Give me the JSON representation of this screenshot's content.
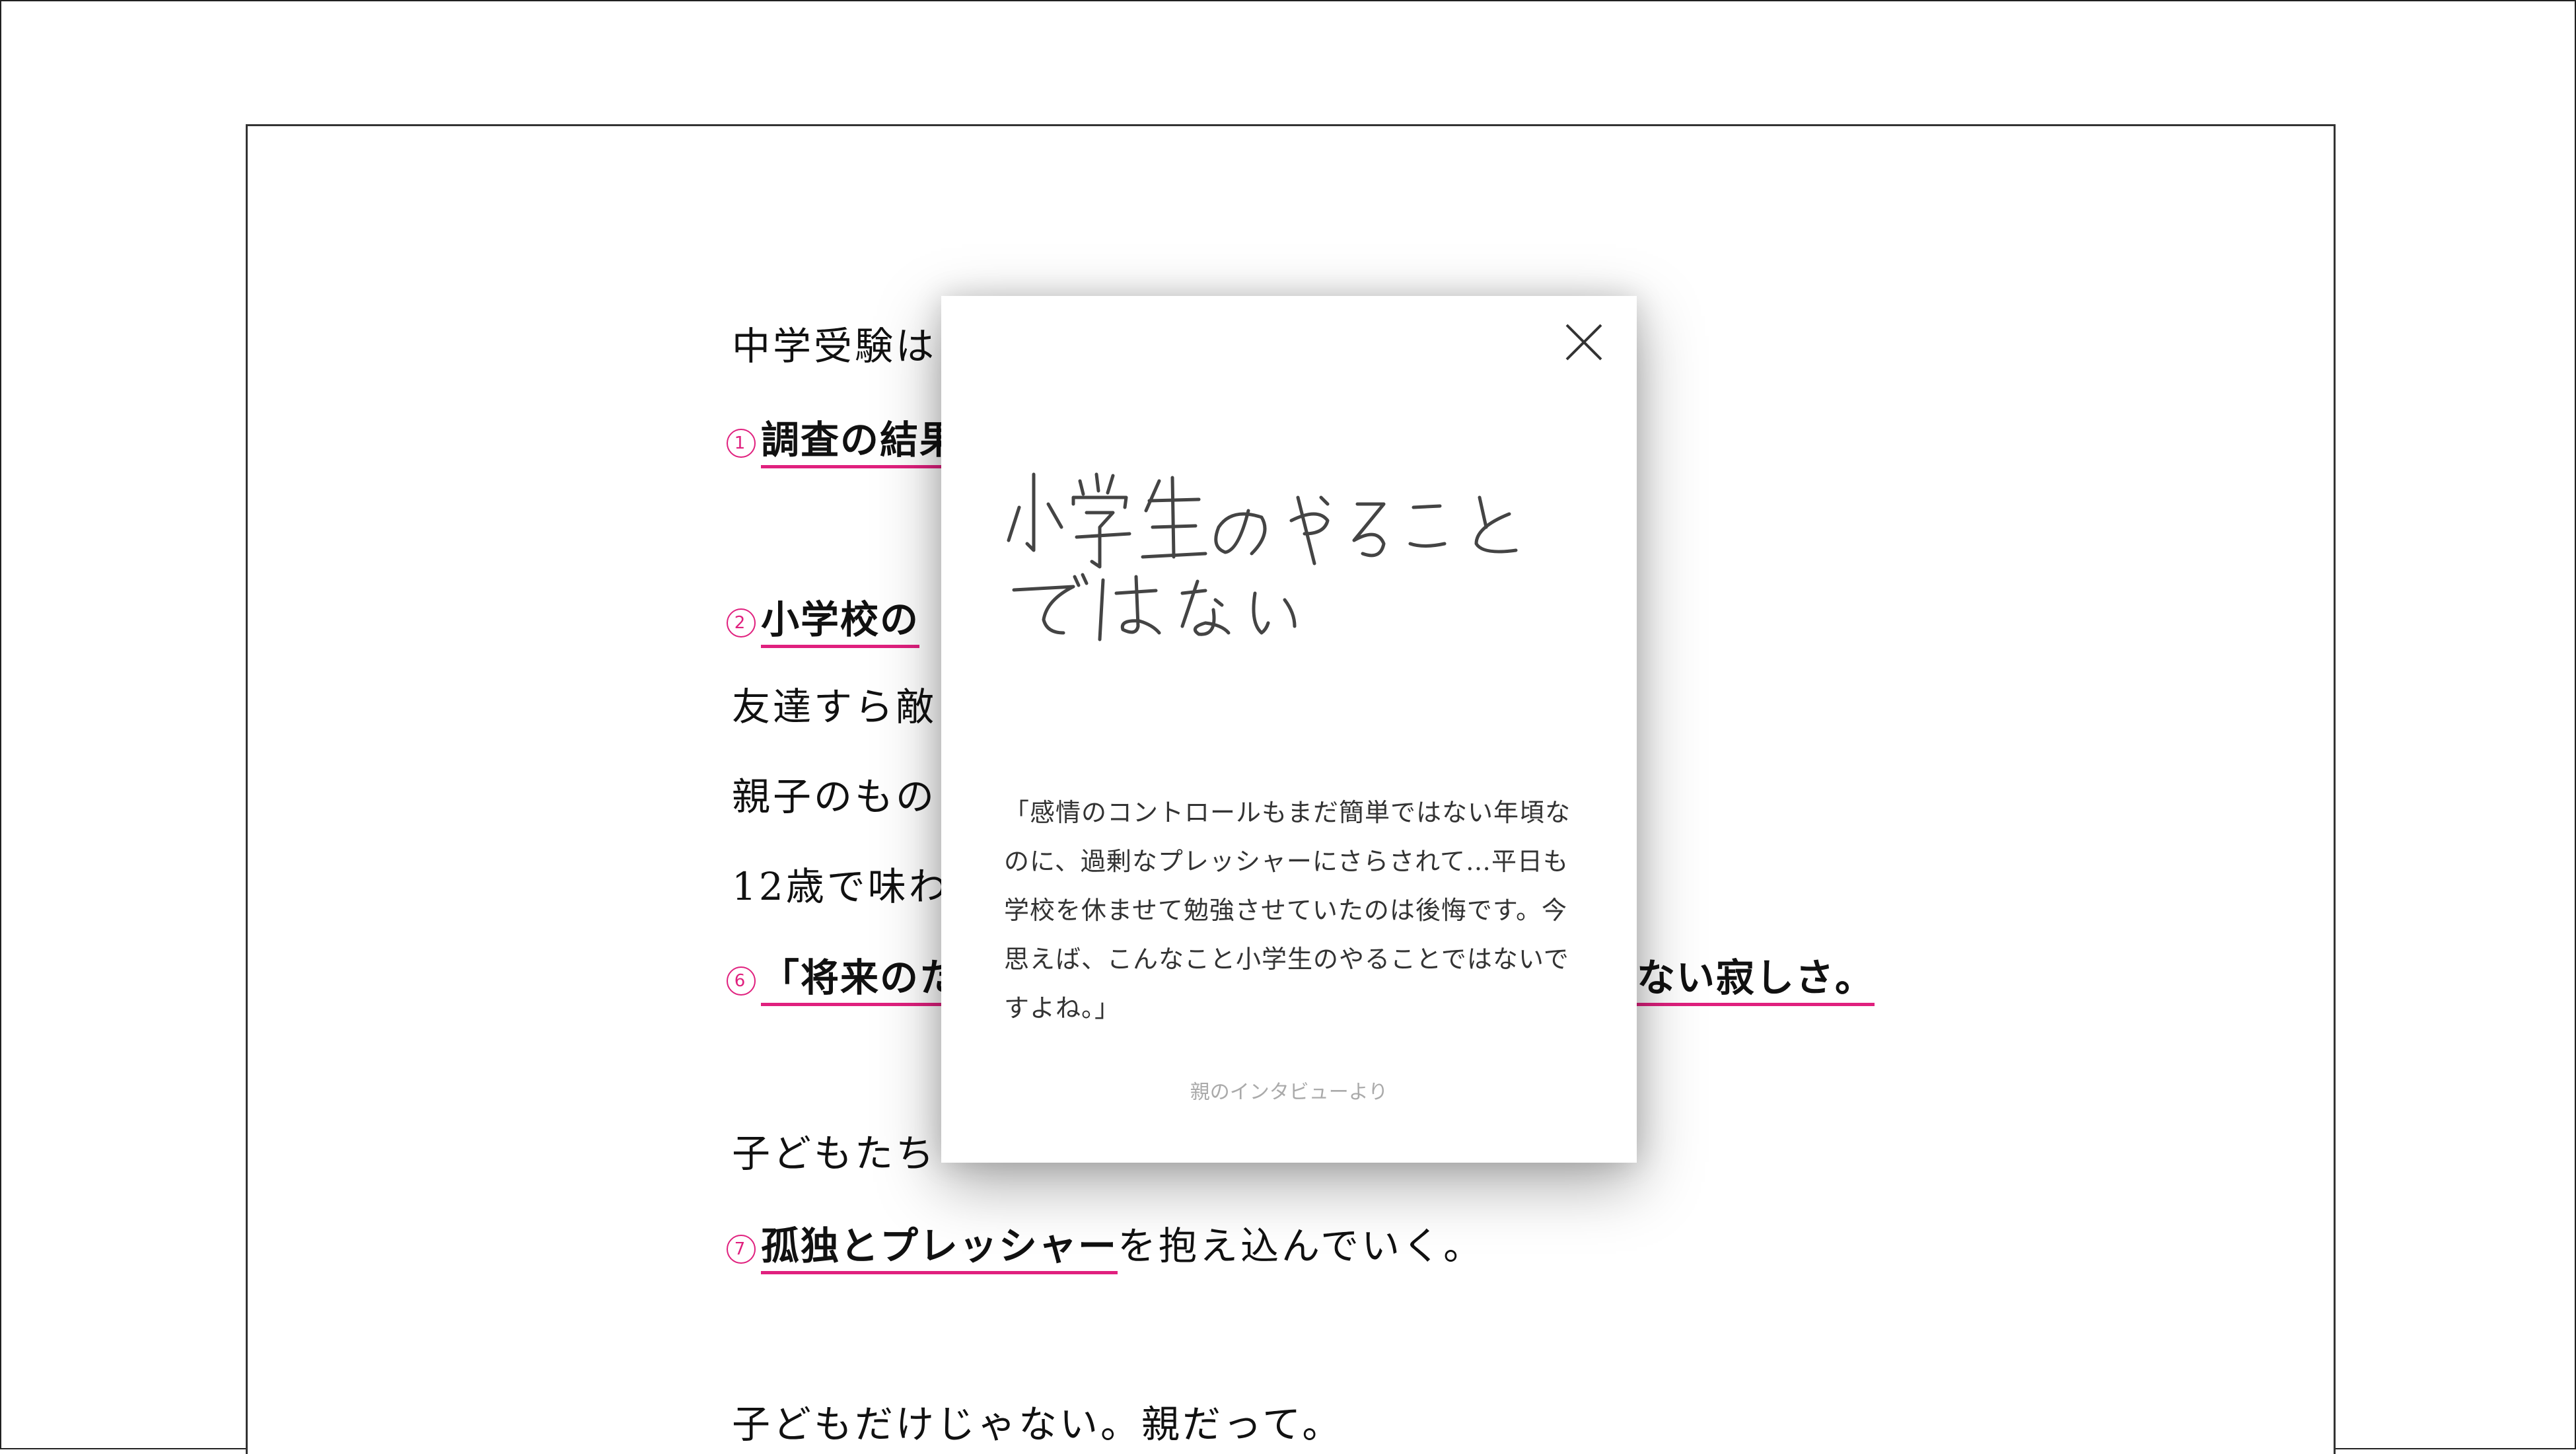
{
  "article": {
    "line1": "中学受験は",
    "item1": {
      "num": "1",
      "text": "調査の結果"
    },
    "item2": {
      "num": "2",
      "text": "小学校の"
    },
    "line_friends": "友達すら敵",
    "line_parent": "親子のもの",
    "line_age": "12歳で味わ",
    "item6": {
      "num": "6",
      "text_left": "「将来のた",
      "text_right": "ない寂しさ。"
    },
    "line_children": "子どもたち",
    "item7": {
      "num": "7",
      "text": "孤独とプレッシャー",
      "suffix": "を抱え込んでいく。"
    },
    "line_last": "子どもだけじゃない。親だって。"
  },
  "modal": {
    "handwriting": "小学生のやることではない",
    "quote": "「感情のコントロールもまだ簡単ではない年頃なのに、過剰なプレッシャーにさらされて…平日も学校を休ませて勉強させていたのは後悔です。今思えば、こんなこと小学生のやることではないですよね。」",
    "source": "親のインタビューより",
    "close_icon": "close-icon"
  },
  "colors": {
    "accent": "#e0207e"
  }
}
